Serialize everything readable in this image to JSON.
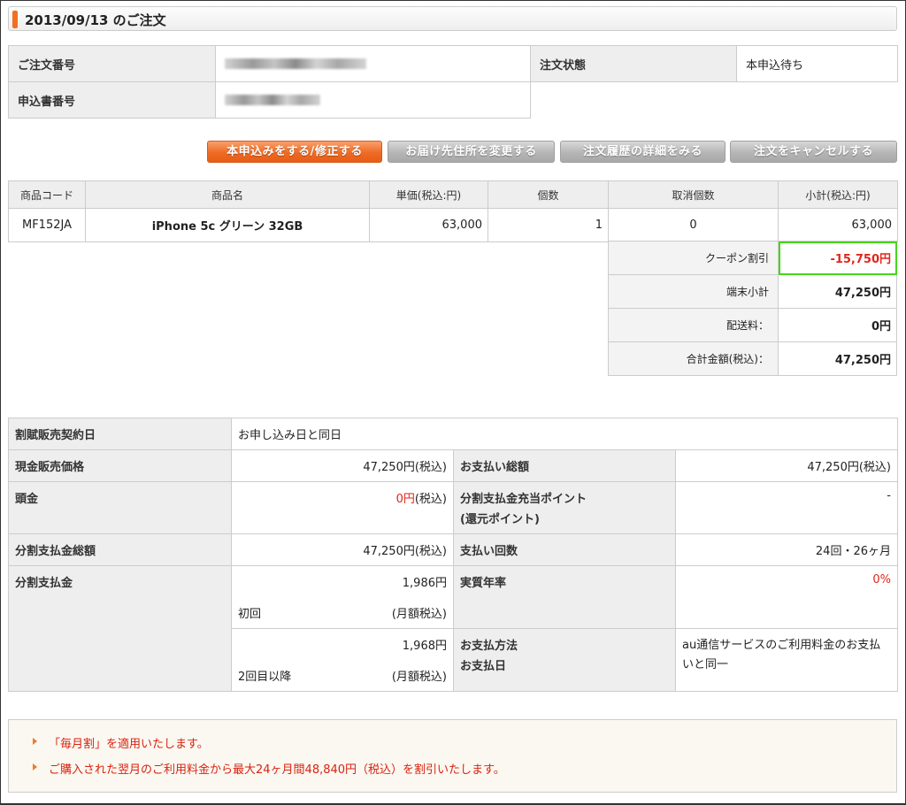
{
  "header": {
    "title": "2013/09/13 のご注文"
  },
  "order_info": {
    "order_number_label": "ご注文番号",
    "order_status_label": "注文状態",
    "order_status_value": "本申込待ち",
    "application_number_label": "申込書番号"
  },
  "buttons": {
    "apply": "本申込みをする/修正する",
    "change_address": "お届け先住所を変更する",
    "history": "注文履歴の詳細をみる",
    "cancel": "注文をキャンセルする"
  },
  "products": {
    "columns": [
      "商品コード",
      "商品名",
      "単価(税込:円)",
      "個数",
      "取消個数",
      "小計(税込:円)"
    ],
    "rows": [
      {
        "code": "MF152JA",
        "name": "iPhone 5c グリーン 32GB",
        "unit_price": "63,000",
        "qty": "1",
        "cancel_qty": "0",
        "subtotal": "63,000"
      }
    ]
  },
  "totals": {
    "coupon_label": "クーポン割引",
    "coupon_value": "-15,750円",
    "device_label": "端末小計",
    "device_value": "47,250円",
    "shipping_label": "配送料：",
    "shipping_value": "0円",
    "total_label": "合計金額(税込)：",
    "total_value": "47,250円"
  },
  "installment": {
    "contract_date_label": "割賦販売契約日",
    "contract_date_value": "お申し込み日と同日",
    "cash_price_label": "現金販売価格",
    "cash_price_value": "47,250円(税込)",
    "total_payment_label": "お支払い総額",
    "total_payment_value": "47,250円(税込)",
    "down_payment_label": "頭金",
    "down_payment_amount": "0円",
    "down_payment_suffix": "(税込)",
    "points_label_1": "分割支払金充当ポイント",
    "points_label_2": "(還元ポイント)",
    "points_value": "-",
    "installment_total_label": "分割支払金総額",
    "installment_total_value": "47,250円(税込)",
    "payment_count_label": "支払い回数",
    "payment_count_value": "24回・26ヶ月",
    "installment_label": "分割支払金",
    "first_amount": "1,986円",
    "first_label": "初回",
    "monthly_tax": "(月額税込)",
    "later_amount": "1,968円",
    "later_label": "2回目以降",
    "apr_label": "実質年率",
    "apr_value": "0%",
    "payment_method_label": "お支払方法",
    "payment_date_label": "お支払日",
    "payment_method_value": "au通信サービスのご利用料金のお支払いと同一"
  },
  "notes": [
    "「毎月割」を適用いたします。",
    "ご購入された翌月のご利用料金から最大24ヶ月間48,840円（税込）を割引いたします。"
  ],
  "colors": {
    "accent": "#f26f21",
    "highlight": "#44d61b",
    "negative": "#e0261b"
  }
}
